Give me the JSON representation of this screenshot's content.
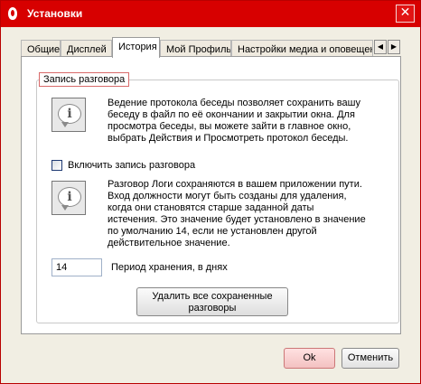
{
  "window": {
    "title": "Установки",
    "close_symbol": "✕",
    "accent_color": "#d70000"
  },
  "tabs": [
    {
      "label": "Общие",
      "active": false
    },
    {
      "label": "Дисплей",
      "active": false
    },
    {
      "label": "История",
      "active": true
    },
    {
      "label": "Мой Профиль",
      "active": false
    },
    {
      "label": "Настройки медиа и оповещений",
      "active": false
    }
  ],
  "tab_scroll": {
    "left": "◀",
    "right": "▶"
  },
  "history": {
    "group_title": "Запись разговора",
    "info_icon": {
      "name": "info-icon",
      "glyph": "i"
    },
    "info_text_1": "Ведение протокола беседы позволяет сохранить вашу беседу в файл по её окончании и закрытии окна. Для просмотра беседы, вы можете зайти в главное окно, выбрать Действия и Просмотреть протокол беседы.",
    "enable_logging_label": "Включить запись разговора",
    "enable_logging_checked": false,
    "info_text_2": "Разговор Логи сохраняются в вашем приложении пути. Вход должности могут быть созданы для удаления, когда они становятся старше заданной даты истечения. Это значение будет установлено в значение по умолчанию 14, если не установлен другой действительное значение.",
    "retention_value": "14",
    "retention_label": "Период хранения, в днях",
    "delete_button_label": "Удалить все сохраненные разговоры"
  },
  "footer": {
    "ok_label": "Ok",
    "cancel_label": "Отменить"
  }
}
